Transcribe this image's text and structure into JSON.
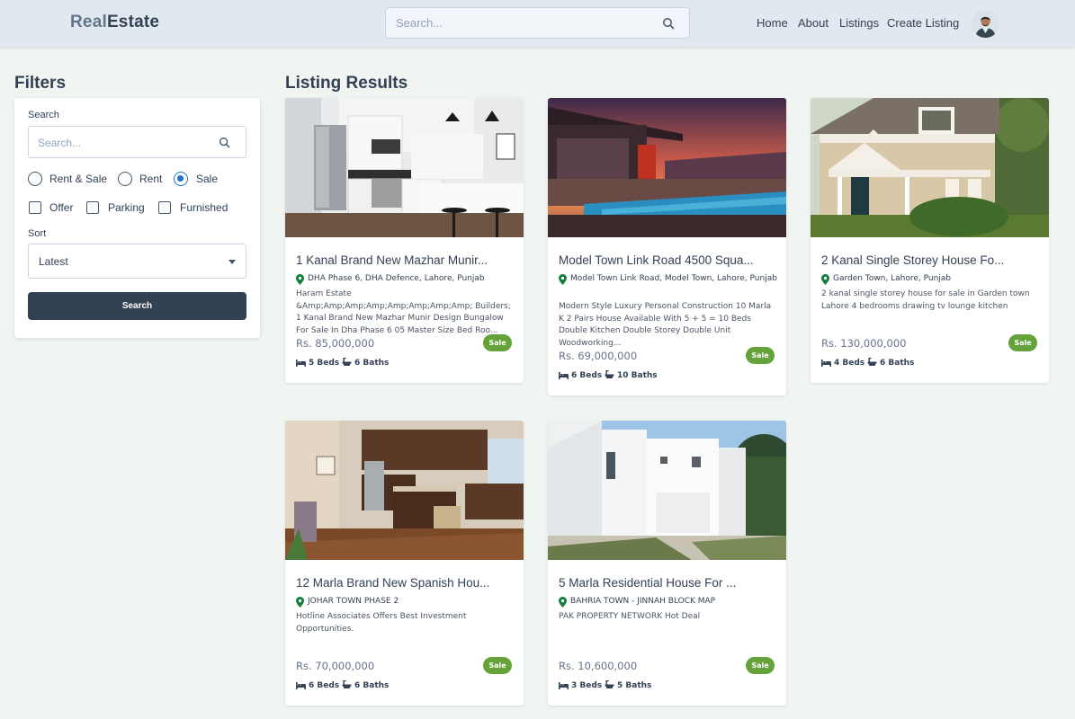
{
  "header": {
    "logo_part1": "Real",
    "logo_part2": "Estate",
    "search_placeholder": "Search...",
    "nav": [
      "Home",
      "About",
      "Listings",
      "Create Listing"
    ]
  },
  "filters": {
    "heading": "Filters",
    "search_label": "Search",
    "search_placeholder": "Search...",
    "type_options": [
      "Rent & Sale",
      "Rent",
      "Sale"
    ],
    "type_selected": "Sale",
    "amenities": [
      "Offer",
      "Parking",
      "Furnished"
    ],
    "sort_label": "Sort",
    "sort_value": "Latest",
    "button_label": "Search"
  },
  "results_heading": "Listing Results",
  "listings": [
    {
      "title": "1 Kanal Brand New Mazhar Munir...",
      "location": "DHA Phase 6, DHA Defence, Lahore, Punjab",
      "description": "Haram Estate &Amp;Amp;Amp;Amp;Amp;Amp;Amp;Amp; Builders; 1 Kanal Brand New Mazhar Munir Design Bungalow For Sale In Dha Phase 6 05 Master Size Bed Roo...",
      "price": "Rs. 85,000,000",
      "badge": "Sale",
      "beds": "5 Beds",
      "baths": "6 Baths",
      "image": "kitchen-photo"
    },
    {
      "title": "Model Town Link Road 4500 Squa...",
      "location": "Model Town Link Road, Model Town, Lahore, Punjab",
      "description": "Modern Style Luxury Personal Construction 10 Marla K 2 Pairs House Available With 5 + 5 = 10 Beds Double Kitchen Double Storey Double Unit Woodworking...",
      "price": "Rs. 69,000,000",
      "badge": "Sale",
      "beds": "6 Beds",
      "baths": "10 Baths",
      "image": "pool-sunset-photo"
    },
    {
      "title": "2 Kanal Single Storey House Fo...",
      "location": "Garden Town, Lahore, Punjab",
      "description": "2 kanal single storey house for sale in Garden town Lahore 4 bedrooms drawing tv lounge kitchen",
      "price": "Rs. 130,000,000",
      "badge": "Sale",
      "beds": "4 Beds",
      "baths": "6 Baths",
      "image": "house-exterior-photo"
    },
    {
      "title": "12 Marla Brand New Spanish Hou...",
      "location": "JOHAR TOWN PHASE 2",
      "description": "Hotline Associates Offers Best Investment Opportunities.",
      "price": "Rs. 70,000,000",
      "badge": "Sale",
      "beds": "6 Beds",
      "baths": "6 Baths",
      "image": "interior-kitchen-photo"
    },
    {
      "title": "5 Marla Residential House For ...",
      "location": "BAHRIA TOWN - JINNAH BLOCK MAP",
      "description": "PAK PROPERTY NETWORK Hot Deal",
      "price": "Rs. 10,600,000",
      "badge": "Sale",
      "beds": "3 Beds",
      "baths": "5 Baths",
      "image": "white-house-photo"
    }
  ],
  "colors": {
    "header_bg": "#e2e8f0",
    "page_bg": "#f1f5f1",
    "primary_dark": "#334155",
    "badge_green": "#65a33a",
    "radio_blue": "#1e70c9",
    "pin_green": "#15803d"
  }
}
